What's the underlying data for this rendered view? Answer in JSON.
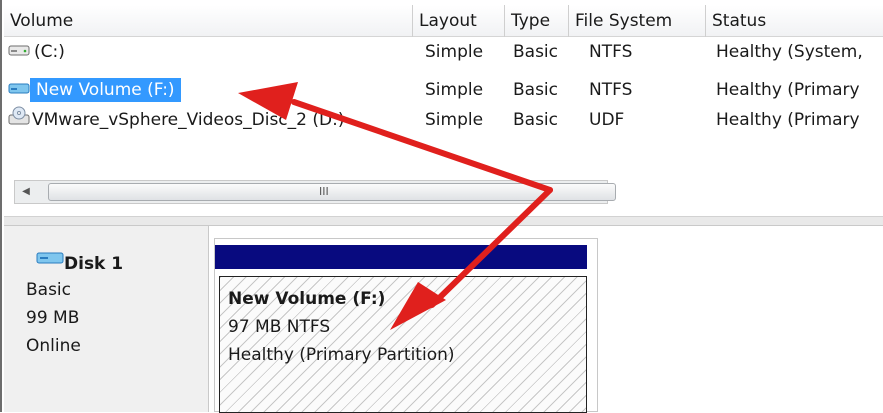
{
  "columns": [
    "Volume",
    "Layout",
    "Type",
    "File System",
    "Status"
  ],
  "rows": [
    {
      "volume": "(C:)",
      "layout": "Simple",
      "type": "Basic",
      "fs": "NTFS",
      "status": "Healthy (System,",
      "icon": "drive-icon",
      "selected": false
    },
    {
      "volume": "New Volume (F:)",
      "layout": "Simple",
      "type": "Basic",
      "fs": "NTFS",
      "status": "Healthy (Primary",
      "icon": "drive-icon",
      "selected": true
    },
    {
      "volume": "VMware_vSphere_Videos_Disc_2 (D:)",
      "layout": "Simple",
      "type": "Basic",
      "fs": "UDF",
      "status": "Healthy (Primary",
      "icon": "cd-drive-icon",
      "selected": false
    }
  ],
  "scroll": {
    "grip": "III"
  },
  "disk": {
    "title": "Disk 1",
    "type": "Basic",
    "size": "99 MB",
    "state": "Online"
  },
  "partition": {
    "name": "New Volume  (F:)",
    "size_fs": "97 MB NTFS",
    "status": "Healthy (Primary Partition)"
  },
  "colors": {
    "selection": "#3399ff",
    "partition_header": "#080a7f",
    "annotation_arrow": "#e0201d"
  }
}
